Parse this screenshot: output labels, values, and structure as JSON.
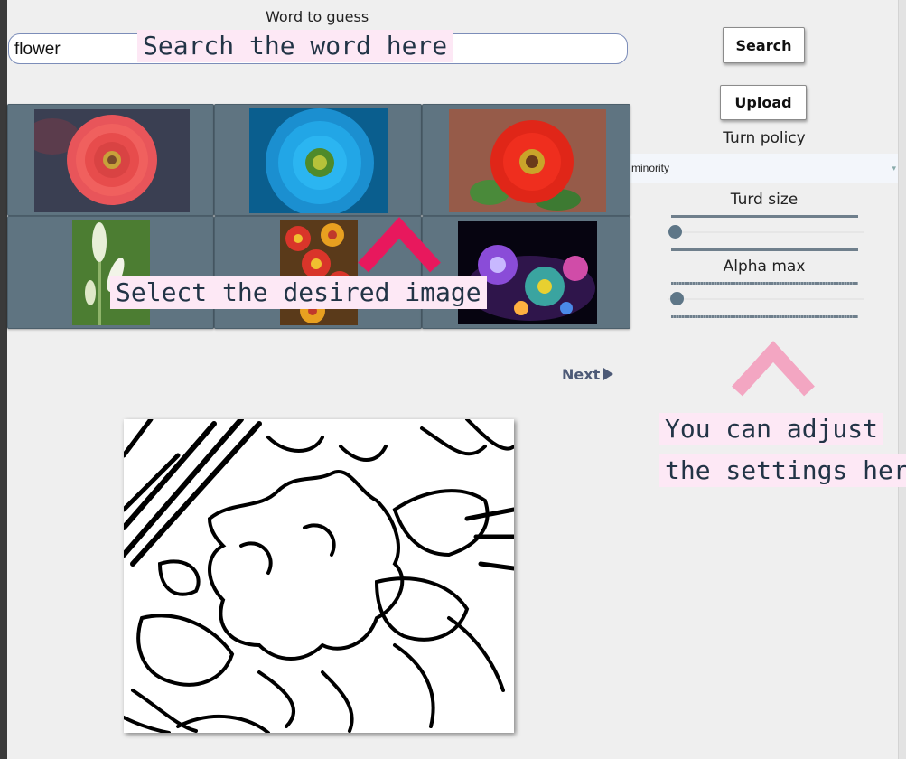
{
  "word_label": "Word to guess",
  "search": {
    "value": "flower"
  },
  "buttons": {
    "search": "Search",
    "upload": "Upload"
  },
  "settings": {
    "turn_policy_label": "Turn policy",
    "turn_policy_value": "minority",
    "turd_size_label": "Turd size",
    "turd_size_level": 0.0,
    "alpha_max_label": "Alpha max",
    "alpha_max_level": 0.01
  },
  "images": [
    {
      "name": "red zinnia"
    },
    {
      "name": "blue daisy"
    },
    {
      "name": "red gerbera"
    },
    {
      "name": "white lily buds"
    },
    {
      "name": "red yellow blanket flowers"
    },
    {
      "name": "purple fractal flowers"
    }
  ],
  "next_label": "Next",
  "hints": {
    "search": "Search the word here",
    "select": "Select the desired image",
    "settings_line1": "You can adjust ",
    "settings_line2": "the settings here"
  },
  "colors": {
    "tile_bg": "#5f7481",
    "hint_bg": "#fde8f5",
    "hint_text": "#223446",
    "chevron_strong": "#e8185d",
    "chevron_soft": "#f3a6c2",
    "accent": "#4d5a77"
  }
}
